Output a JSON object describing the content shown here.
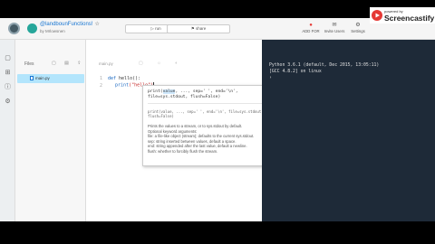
{
  "header": {
    "repl_title": "@landbounFunctions!",
    "star": "☆",
    "repl_user": "by Mrlowsnen",
    "run_label": "▷ run",
    "share_label": "⚑ share",
    "actions": [
      {
        "icon": "record-icon",
        "glyph": "●",
        "label": "ADD FOR"
      },
      {
        "icon": "invite-icon",
        "glyph": "✉",
        "label": "Invite Users"
      },
      {
        "icon": "settings-icon",
        "glyph": "⚙",
        "label": "Settings"
      }
    ]
  },
  "brand": {
    "small": "powered by",
    "name": "Screencastify"
  },
  "files": {
    "title": "Files",
    "tools": "▢ ▤ ⇪",
    "items": [
      {
        "name": "main.py"
      }
    ]
  },
  "editor": {
    "tab": "main.py",
    "tools": "▢ ☼ ◐",
    "lines": [
      {
        "n": "1",
        "code_kw": "def",
        "code_rest": " hello():"
      },
      {
        "n": "2",
        "code_kw": "print",
        "code_rest": "(\"hello\")"
      }
    ]
  },
  "tooltip": {
    "signature_pre": "print(",
    "signature_hl": "value",
    "signature_post": ", ..., sep=' ', end='\\n', file=sys.stdout, flush=False)",
    "sub": "print(value, ..., sep=' ', end='\\n', file=sys.stdout, flush=False)",
    "desc": [
      "Prints the values to a stream, or to sys.stdout by default.",
      "Optional keyword arguments:",
      "file:  a file-like object (stream); defaults to the current sys.stdout.",
      "sep:   string inserted between values, default a space.",
      "end:   string appended after the last value, default a newline.",
      "flush: whether to forcibly flush the stream."
    ]
  },
  "console": {
    "lines": [
      "Python 3.6.1 (default, Dec 2015, 13:05:11)",
      "[GCC 4.8.2] on linux",
      "›"
    ]
  },
  "recorder": {
    "buttons": [
      "❚❚",
      "➤",
      "✎",
      "▰",
      "◐",
      "●",
      "▣"
    ]
  }
}
